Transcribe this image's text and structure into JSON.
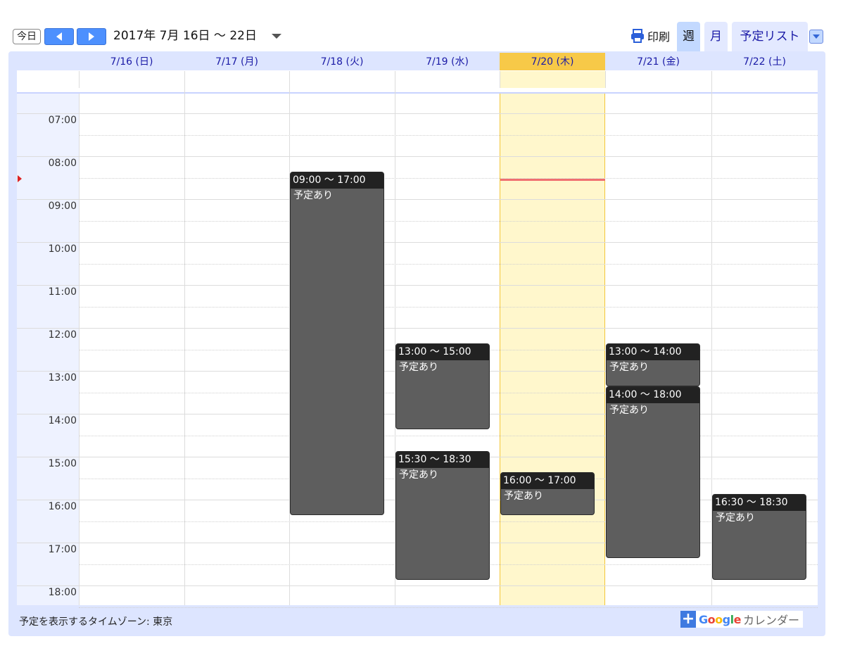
{
  "toolbar": {
    "today_label": "今日",
    "range_title": "2017年 7月 16日 〜 22日",
    "print_label": "印刷",
    "tabs": {
      "week": "週",
      "month": "月",
      "agenda": "予定リスト"
    }
  },
  "days": [
    {
      "label": "7/16 (日)",
      "today": false
    },
    {
      "label": "7/17 (月)",
      "today": false
    },
    {
      "label": "7/18 (火)",
      "today": false
    },
    {
      "label": "7/19 (水)",
      "today": false
    },
    {
      "label": "7/20 (木)",
      "today": true
    },
    {
      "label": "7/21 (金)",
      "today": false
    },
    {
      "label": "7/22 (土)",
      "today": false
    }
  ],
  "hours": [
    "07:00",
    "08:00",
    "09:00",
    "10:00",
    "11:00",
    "12:00",
    "13:00",
    "14:00",
    "15:00",
    "16:00",
    "17:00",
    "18:00"
  ],
  "events": [
    {
      "day": 2,
      "start": 9.0,
      "end": 17.0,
      "time": "09:00 〜 17:00",
      "title": "予定あり"
    },
    {
      "day": 3,
      "start": 13.0,
      "end": 15.0,
      "time": "13:00 〜 15:00",
      "title": "予定あり"
    },
    {
      "day": 3,
      "start": 15.5,
      "end": 18.5,
      "time": "15:30 〜 18:30",
      "title": "予定あり"
    },
    {
      "day": 4,
      "start": 16.0,
      "end": 17.0,
      "time": "16:00 〜 17:00",
      "title": "予定あり"
    },
    {
      "day": 5,
      "start": 13.0,
      "end": 14.0,
      "time": "13:00 〜 14:00",
      "title": "予定あり"
    },
    {
      "day": 5,
      "start": 14.0,
      "end": 18.0,
      "time": "14:00 〜 18:00",
      "title": "予定あり"
    },
    {
      "day": 6,
      "start": 16.5,
      "end": 18.5,
      "time": "16:30 〜 18:30",
      "title": "予定あり"
    }
  ],
  "footer": {
    "timezone_text": "予定を表示するタイムゾーン: 東京",
    "gcal_plus": "+",
    "gcal_google": [
      "G",
      "o",
      "o",
      "g",
      "l",
      "e"
    ],
    "gcal_suffix": "カレンダー"
  },
  "colors": {
    "nav_button": "#4d90fe",
    "today_header": "#f7c948",
    "today_column": "#fff7cc",
    "event_body": "#5e5e5e",
    "event_header": "#222222",
    "now_line": "#f07070",
    "day_header_text": "#1a1aa6"
  },
  "icons": [
    "chevron-left-icon",
    "chevron-right-icon",
    "caret-down-icon",
    "printer-icon"
  ]
}
